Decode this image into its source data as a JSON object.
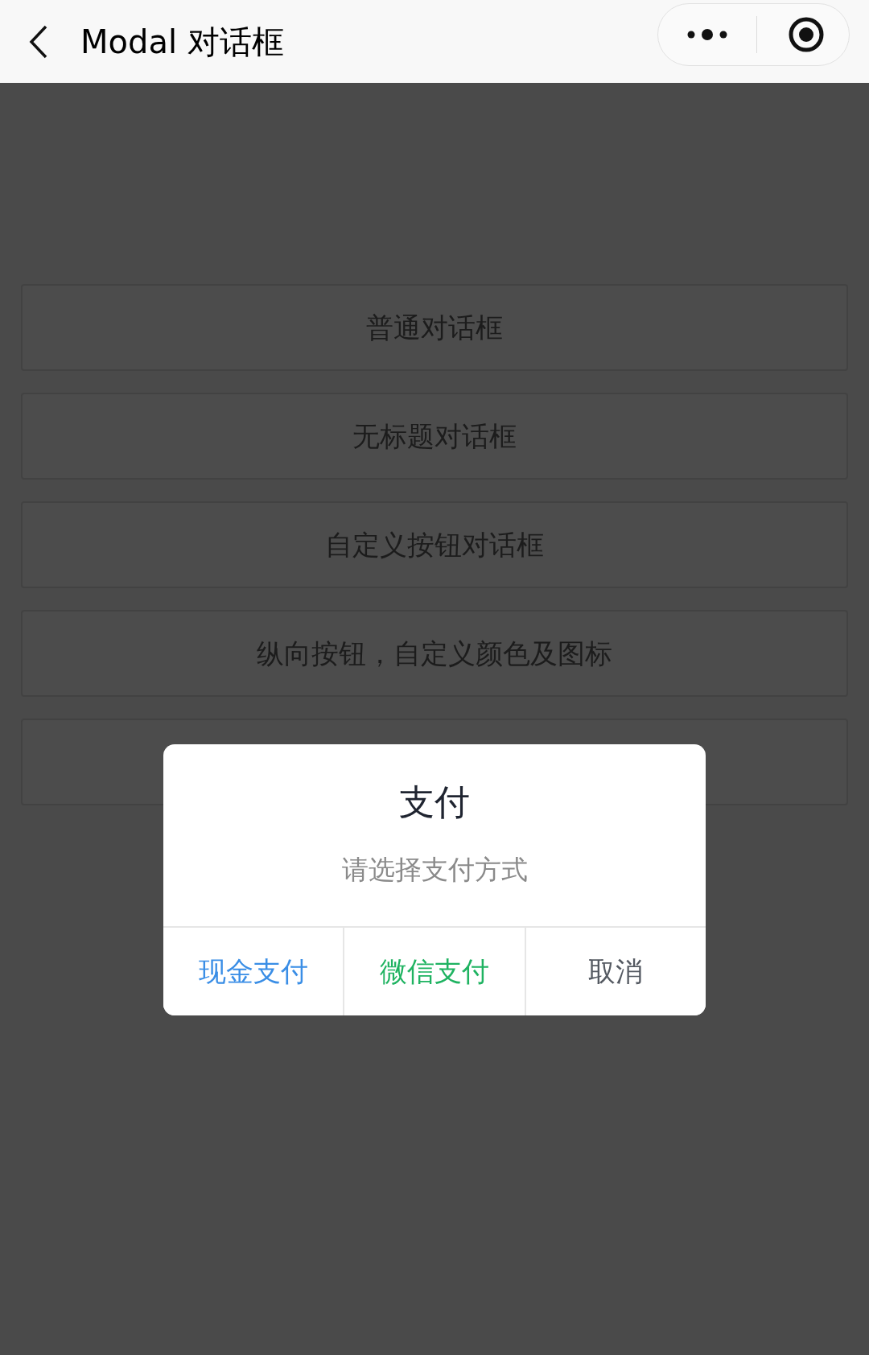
{
  "nav_bar": {
    "title": "Modal 对话框"
  },
  "buttons": [
    {
      "kind": "button",
      "label": "普通对话框"
    },
    {
      "kind": "button",
      "label": "无标题对话框"
    },
    {
      "kind": "button",
      "label": "自定义按钮对话框"
    },
    {
      "kind": "button",
      "label": "纵向按钮，自定义颜色及图标"
    },
    {
      "kind": "button"
    }
  ],
  "modal": {
    "title": "支付",
    "content": "请选择支付方式",
    "actions": [
      {
        "label": "现金支付",
        "color": "#3a8ee6"
      },
      {
        "label": "微信支付",
        "color": "#1fb361"
      },
      {
        "label": "取消",
        "color": "#555a62"
      }
    ]
  }
}
